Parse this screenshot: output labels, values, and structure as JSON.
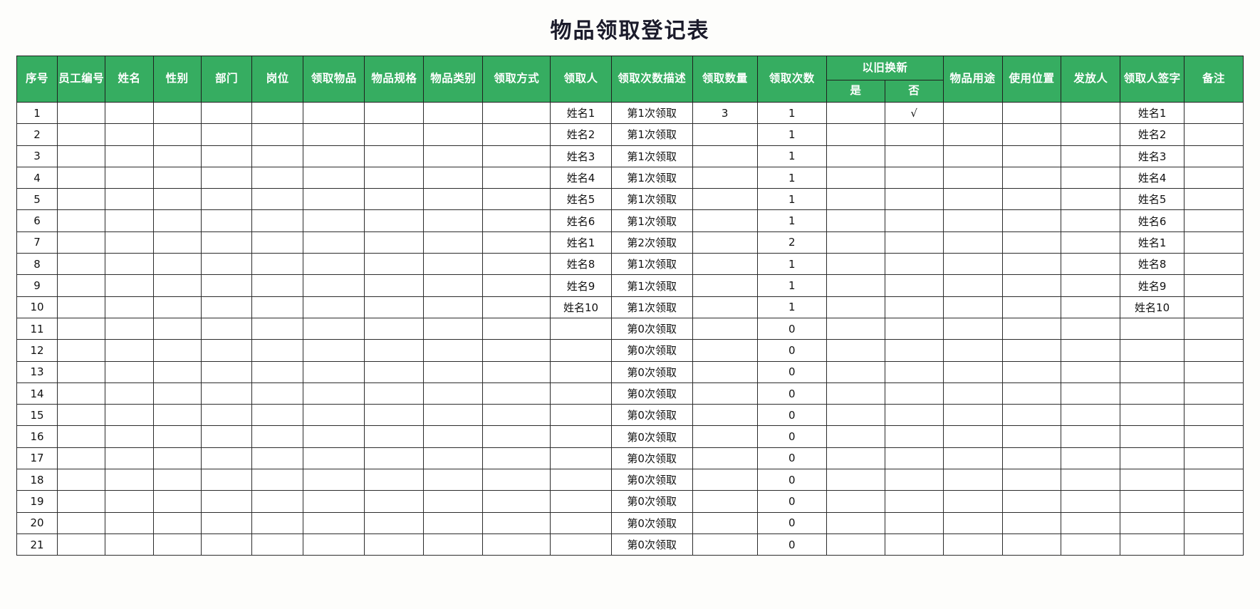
{
  "document": {
    "title": "物品领取登记表"
  },
  "table": {
    "headers": {
      "seq": "序号",
      "emp_no": "员工编号",
      "name": "姓名",
      "gender": "性别",
      "dept": "部门",
      "post": "岗位",
      "item": "领取物品",
      "spec": "物品规格",
      "category": "物品类别",
      "method": "领取方式",
      "receiver": "领取人",
      "times_desc": "领取次数描述",
      "quantity": "领取数量",
      "times": "领取次数",
      "trade_in": "以旧换新",
      "trade_in_yes": "是",
      "trade_in_no": "否",
      "usage": "物品用途",
      "location": "使用位置",
      "issuer": "发放人",
      "signature": "领取人签字",
      "remark": "备注"
    },
    "rows": [
      {
        "seq": "1",
        "emp_no": "",
        "name": "",
        "gender": "",
        "dept": "",
        "post": "",
        "item": "",
        "spec": "",
        "category": "",
        "method": "",
        "receiver": "姓名1",
        "times_desc": "第1次领取",
        "quantity": "3",
        "times": "1",
        "trade_in_yes": "",
        "trade_in_no": "√",
        "usage": "",
        "location": "",
        "issuer": "",
        "signature": "姓名1",
        "remark": ""
      },
      {
        "seq": "2",
        "emp_no": "",
        "name": "",
        "gender": "",
        "dept": "",
        "post": "",
        "item": "",
        "spec": "",
        "category": "",
        "method": "",
        "receiver": "姓名2",
        "times_desc": "第1次领取",
        "quantity": "",
        "times": "1",
        "trade_in_yes": "",
        "trade_in_no": "",
        "usage": "",
        "location": "",
        "issuer": "",
        "signature": "姓名2",
        "remark": ""
      },
      {
        "seq": "3",
        "emp_no": "",
        "name": "",
        "gender": "",
        "dept": "",
        "post": "",
        "item": "",
        "spec": "",
        "category": "",
        "method": "",
        "receiver": "姓名3",
        "times_desc": "第1次领取",
        "quantity": "",
        "times": "1",
        "trade_in_yes": "",
        "trade_in_no": "",
        "usage": "",
        "location": "",
        "issuer": "",
        "signature": "姓名3",
        "remark": ""
      },
      {
        "seq": "4",
        "emp_no": "",
        "name": "",
        "gender": "",
        "dept": "",
        "post": "",
        "item": "",
        "spec": "",
        "category": "",
        "method": "",
        "receiver": "姓名4",
        "times_desc": "第1次领取",
        "quantity": "",
        "times": "1",
        "trade_in_yes": "",
        "trade_in_no": "",
        "usage": "",
        "location": "",
        "issuer": "",
        "signature": "姓名4",
        "remark": ""
      },
      {
        "seq": "5",
        "emp_no": "",
        "name": "",
        "gender": "",
        "dept": "",
        "post": "",
        "item": "",
        "spec": "",
        "category": "",
        "method": "",
        "receiver": "姓名5",
        "times_desc": "第1次领取",
        "quantity": "",
        "times": "1",
        "trade_in_yes": "",
        "trade_in_no": "",
        "usage": "",
        "location": "",
        "issuer": "",
        "signature": "姓名5",
        "remark": ""
      },
      {
        "seq": "6",
        "emp_no": "",
        "name": "",
        "gender": "",
        "dept": "",
        "post": "",
        "item": "",
        "spec": "",
        "category": "",
        "method": "",
        "receiver": "姓名6",
        "times_desc": "第1次领取",
        "quantity": "",
        "times": "1",
        "trade_in_yes": "",
        "trade_in_no": "",
        "usage": "",
        "location": "",
        "issuer": "",
        "signature": "姓名6",
        "remark": ""
      },
      {
        "seq": "7",
        "emp_no": "",
        "name": "",
        "gender": "",
        "dept": "",
        "post": "",
        "item": "",
        "spec": "",
        "category": "",
        "method": "",
        "receiver": "姓名1",
        "times_desc": "第2次领取",
        "quantity": "",
        "times": "2",
        "trade_in_yes": "",
        "trade_in_no": "",
        "usage": "",
        "location": "",
        "issuer": "",
        "signature": "姓名1",
        "remark": ""
      },
      {
        "seq": "8",
        "emp_no": "",
        "name": "",
        "gender": "",
        "dept": "",
        "post": "",
        "item": "",
        "spec": "",
        "category": "",
        "method": "",
        "receiver": "姓名8",
        "times_desc": "第1次领取",
        "quantity": "",
        "times": "1",
        "trade_in_yes": "",
        "trade_in_no": "",
        "usage": "",
        "location": "",
        "issuer": "",
        "signature": "姓名8",
        "remark": ""
      },
      {
        "seq": "9",
        "emp_no": "",
        "name": "",
        "gender": "",
        "dept": "",
        "post": "",
        "item": "",
        "spec": "",
        "category": "",
        "method": "",
        "receiver": "姓名9",
        "times_desc": "第1次领取",
        "quantity": "",
        "times": "1",
        "trade_in_yes": "",
        "trade_in_no": "",
        "usage": "",
        "location": "",
        "issuer": "",
        "signature": "姓名9",
        "remark": ""
      },
      {
        "seq": "10",
        "emp_no": "",
        "name": "",
        "gender": "",
        "dept": "",
        "post": "",
        "item": "",
        "spec": "",
        "category": "",
        "method": "",
        "receiver": "姓名10",
        "times_desc": "第1次领取",
        "quantity": "",
        "times": "1",
        "trade_in_yes": "",
        "trade_in_no": "",
        "usage": "",
        "location": "",
        "issuer": "",
        "signature": "姓名10",
        "remark": ""
      },
      {
        "seq": "11",
        "emp_no": "",
        "name": "",
        "gender": "",
        "dept": "",
        "post": "",
        "item": "",
        "spec": "",
        "category": "",
        "method": "",
        "receiver": "",
        "times_desc": "第0次领取",
        "quantity": "",
        "times": "0",
        "trade_in_yes": "",
        "trade_in_no": "",
        "usage": "",
        "location": "",
        "issuer": "",
        "signature": "",
        "remark": ""
      },
      {
        "seq": "12",
        "emp_no": "",
        "name": "",
        "gender": "",
        "dept": "",
        "post": "",
        "item": "",
        "spec": "",
        "category": "",
        "method": "",
        "receiver": "",
        "times_desc": "第0次领取",
        "quantity": "",
        "times": "0",
        "trade_in_yes": "",
        "trade_in_no": "",
        "usage": "",
        "location": "",
        "issuer": "",
        "signature": "",
        "remark": ""
      },
      {
        "seq": "13",
        "emp_no": "",
        "name": "",
        "gender": "",
        "dept": "",
        "post": "",
        "item": "",
        "spec": "",
        "category": "",
        "method": "",
        "receiver": "",
        "times_desc": "第0次领取",
        "quantity": "",
        "times": "0",
        "trade_in_yes": "",
        "trade_in_no": "",
        "usage": "",
        "location": "",
        "issuer": "",
        "signature": "",
        "remark": ""
      },
      {
        "seq": "14",
        "emp_no": "",
        "name": "",
        "gender": "",
        "dept": "",
        "post": "",
        "item": "",
        "spec": "",
        "category": "",
        "method": "",
        "receiver": "",
        "times_desc": "第0次领取",
        "quantity": "",
        "times": "0",
        "trade_in_yes": "",
        "trade_in_no": "",
        "usage": "",
        "location": "",
        "issuer": "",
        "signature": "",
        "remark": ""
      },
      {
        "seq": "15",
        "emp_no": "",
        "name": "",
        "gender": "",
        "dept": "",
        "post": "",
        "item": "",
        "spec": "",
        "category": "",
        "method": "",
        "receiver": "",
        "times_desc": "第0次领取",
        "quantity": "",
        "times": "0",
        "trade_in_yes": "",
        "trade_in_no": "",
        "usage": "",
        "location": "",
        "issuer": "",
        "signature": "",
        "remark": ""
      },
      {
        "seq": "16",
        "emp_no": "",
        "name": "",
        "gender": "",
        "dept": "",
        "post": "",
        "item": "",
        "spec": "",
        "category": "",
        "method": "",
        "receiver": "",
        "times_desc": "第0次领取",
        "quantity": "",
        "times": "0",
        "trade_in_yes": "",
        "trade_in_no": "",
        "usage": "",
        "location": "",
        "issuer": "",
        "signature": "",
        "remark": ""
      },
      {
        "seq": "17",
        "emp_no": "",
        "name": "",
        "gender": "",
        "dept": "",
        "post": "",
        "item": "",
        "spec": "",
        "category": "",
        "method": "",
        "receiver": "",
        "times_desc": "第0次领取",
        "quantity": "",
        "times": "0",
        "trade_in_yes": "",
        "trade_in_no": "",
        "usage": "",
        "location": "",
        "issuer": "",
        "signature": "",
        "remark": ""
      },
      {
        "seq": "18",
        "emp_no": "",
        "name": "",
        "gender": "",
        "dept": "",
        "post": "",
        "item": "",
        "spec": "",
        "category": "",
        "method": "",
        "receiver": "",
        "times_desc": "第0次领取",
        "quantity": "",
        "times": "0",
        "trade_in_yes": "",
        "trade_in_no": "",
        "usage": "",
        "location": "",
        "issuer": "",
        "signature": "",
        "remark": ""
      },
      {
        "seq": "19",
        "emp_no": "",
        "name": "",
        "gender": "",
        "dept": "",
        "post": "",
        "item": "",
        "spec": "",
        "category": "",
        "method": "",
        "receiver": "",
        "times_desc": "第0次领取",
        "quantity": "",
        "times": "0",
        "trade_in_yes": "",
        "trade_in_no": "",
        "usage": "",
        "location": "",
        "issuer": "",
        "signature": "",
        "remark": ""
      },
      {
        "seq": "20",
        "emp_no": "",
        "name": "",
        "gender": "",
        "dept": "",
        "post": "",
        "item": "",
        "spec": "",
        "category": "",
        "method": "",
        "receiver": "",
        "times_desc": "第0次领取",
        "quantity": "",
        "times": "0",
        "trade_in_yes": "",
        "trade_in_no": "",
        "usage": "",
        "location": "",
        "issuer": "",
        "signature": "",
        "remark": ""
      },
      {
        "seq": "21",
        "emp_no": "",
        "name": "",
        "gender": "",
        "dept": "",
        "post": "",
        "item": "",
        "spec": "",
        "category": "",
        "method": "",
        "receiver": "",
        "times_desc": "第0次领取",
        "quantity": "",
        "times": "0",
        "trade_in_yes": "",
        "trade_in_no": "",
        "usage": "",
        "location": "",
        "issuer": "",
        "signature": "",
        "remark": ""
      }
    ]
  },
  "colors": {
    "header_green": "#36ad61",
    "grid_line": "#2b2b2b",
    "page_background": "#fdfdfb"
  }
}
